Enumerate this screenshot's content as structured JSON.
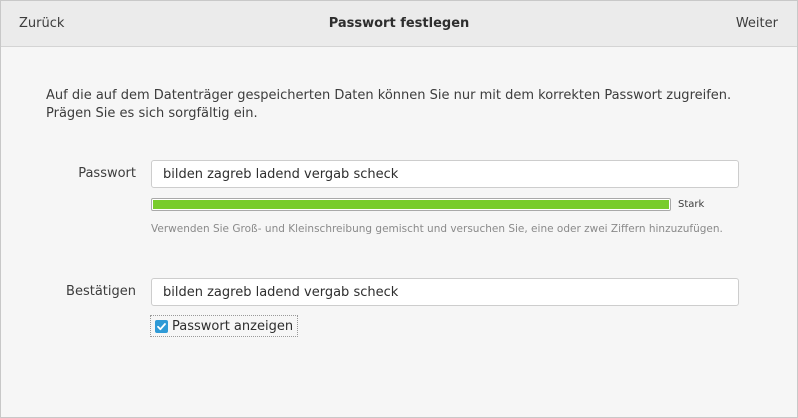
{
  "headerbar": {
    "back_label": "Zurück",
    "title": "Passwort festlegen",
    "next_label": "Weiter"
  },
  "intro_text": "Auf die auf dem Datenträger gespeicherten Daten können Sie nur mit dem korrekten Passwort zugreifen. Prägen Sie es sich sorgfältig ein.",
  "password": {
    "label": "Passwort",
    "value": "bilden zagreb ladend vergab scheck"
  },
  "strength": {
    "level": 1.0,
    "label": "Stark",
    "bar_color": "#78cc2b"
  },
  "hint": "Verwenden Sie Groß- und Kleinschreibung gemischt und versuchen Sie, eine oder zwei Ziffern hinzuzufügen.",
  "confirm": {
    "label": "Bestätigen",
    "value": "bilden zagreb ladend vergab scheck"
  },
  "show_password": {
    "label": "Passwort anzeigen",
    "checked": true,
    "accent": "#2f9ad6"
  }
}
